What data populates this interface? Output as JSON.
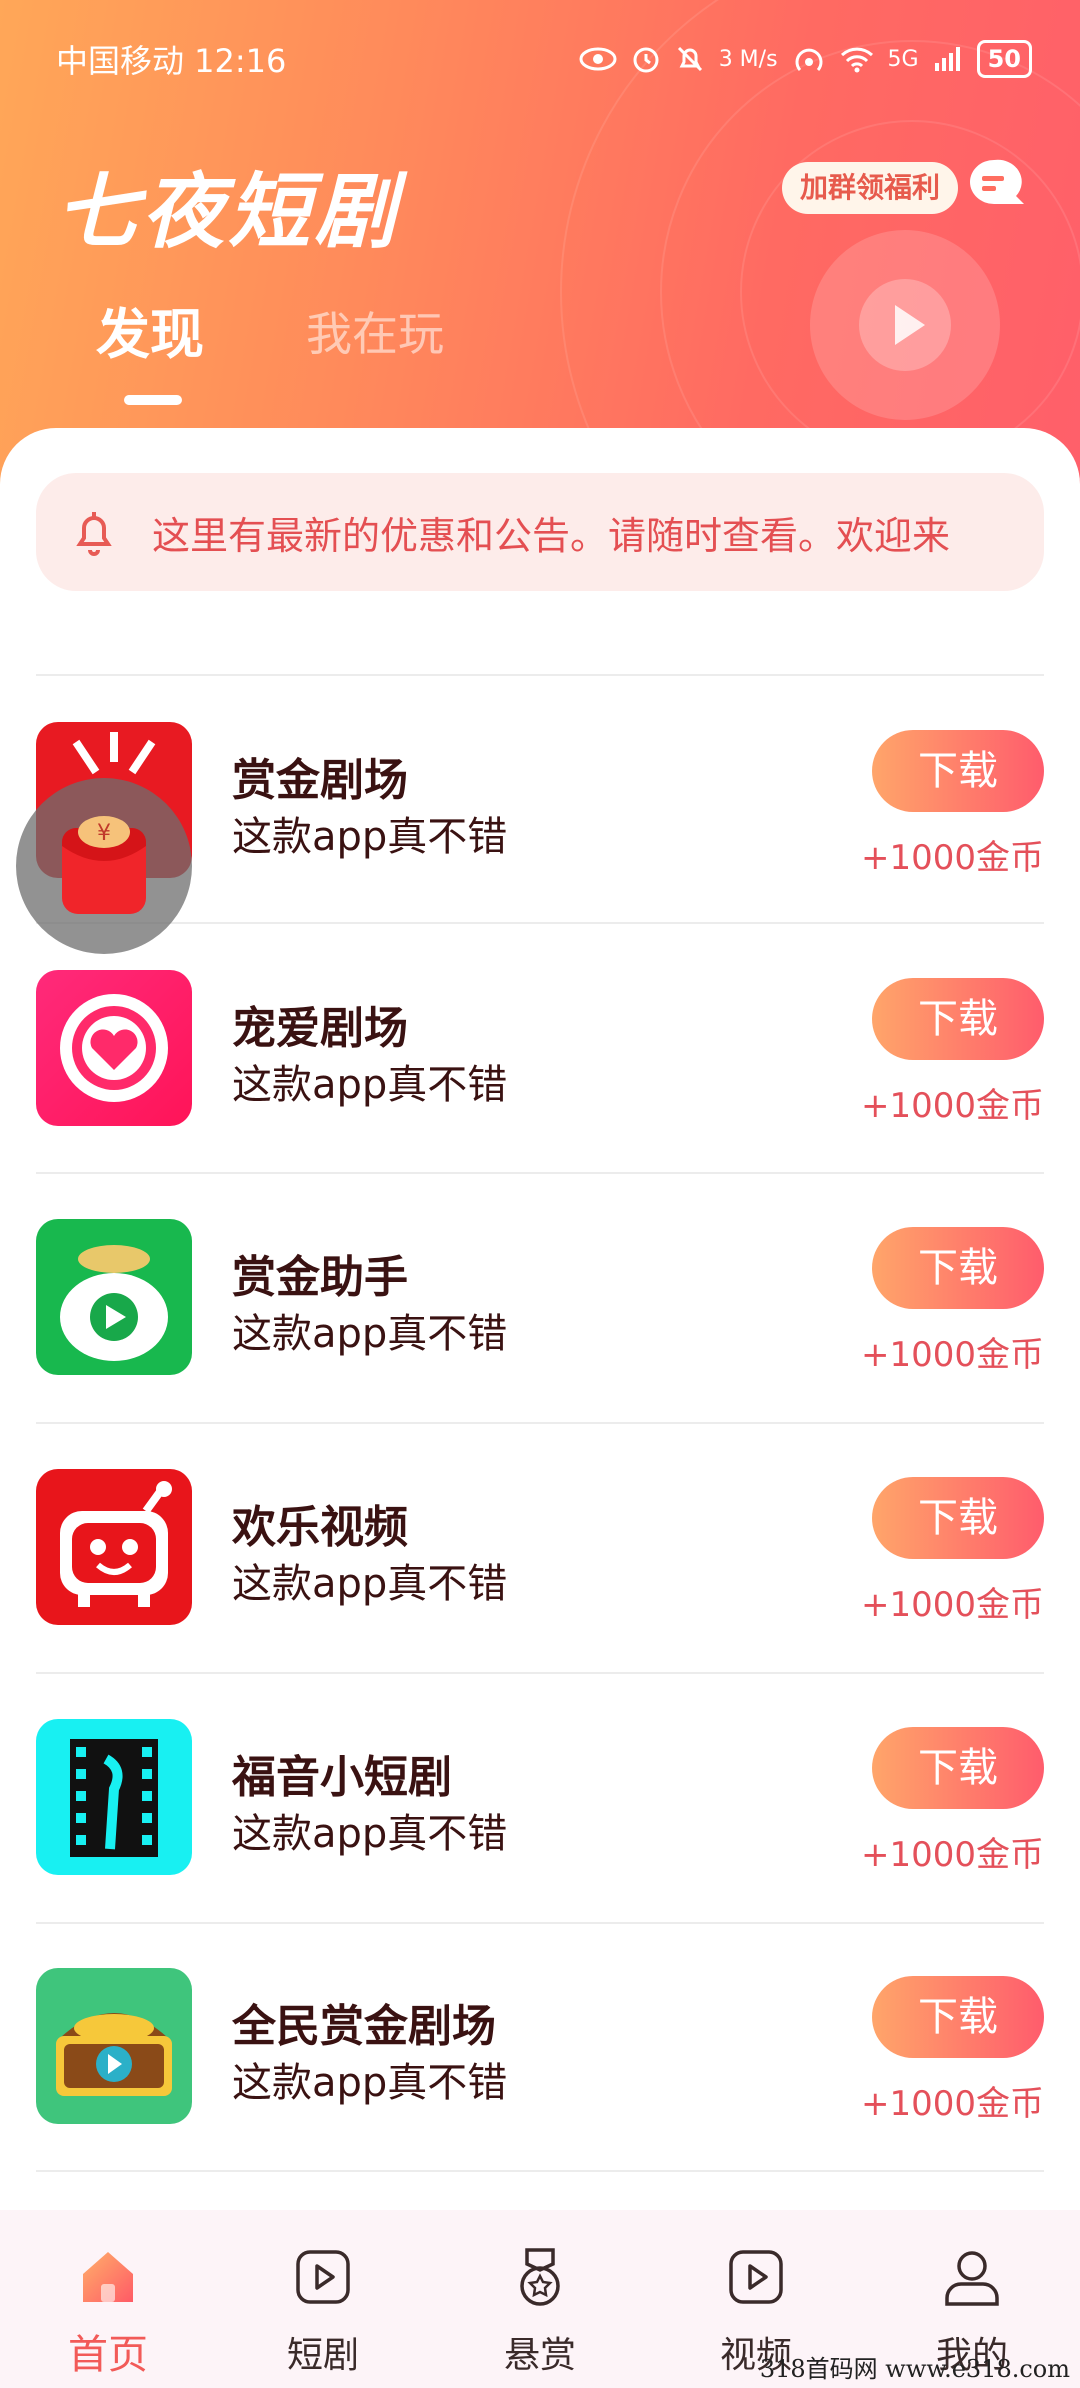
{
  "status_bar": {
    "carrier_time": "中国移动 12:16",
    "speed": "3 M/s",
    "network": "5G",
    "battery": "50"
  },
  "header": {
    "app_title": "七夜短剧",
    "group_button": "加群领福利",
    "tabs": [
      {
        "label": "发现",
        "active": true
      },
      {
        "label": "我在玩",
        "active": false
      }
    ]
  },
  "notice": {
    "text": "这里有最新的优惠和公告。请随时查看。欢迎来"
  },
  "apps": [
    {
      "name": "赏金剧场",
      "desc": "这款app真不错",
      "button": "下载",
      "reward": "+1000金币",
      "icon": "theater-icon"
    },
    {
      "name": "宠爱剧场",
      "desc": "这款app真不错",
      "button": "下载",
      "reward": "+1000金币",
      "icon": "heart-icon"
    },
    {
      "name": "赏金助手",
      "desc": "这款app真不错",
      "button": "下载",
      "reward": "+1000金币",
      "icon": "money-bag-icon"
    },
    {
      "name": "欢乐视频",
      "desc": "这款app真不错",
      "button": "下载",
      "reward": "+1000金币",
      "icon": "tv-face-icon"
    },
    {
      "name": "福音小短剧",
      "desc": "这款app真不错",
      "button": "下载",
      "reward": "+1000金币",
      "icon": "film-strip-icon"
    },
    {
      "name": "全民赏金剧场",
      "desc": "这款app真不错",
      "button": "下载",
      "reward": "+1000金币",
      "icon": "treasure-chest-icon"
    }
  ],
  "floating": {
    "icon": "red-packet-icon",
    "symbol": "¥"
  },
  "nav": [
    {
      "label": "首页",
      "icon": "home-icon",
      "active": true
    },
    {
      "label": "短剧",
      "icon": "play-square-icon",
      "active": false
    },
    {
      "label": "悬赏",
      "icon": "medal-icon",
      "active": false
    },
    {
      "label": "视频",
      "icon": "video-icon",
      "active": false
    },
    {
      "label": "我的",
      "icon": "user-icon",
      "active": false
    }
  ],
  "watermark": "318首码网  www.e318.com",
  "colors": {
    "header_start": "#ffa758",
    "header_end": "#ff5f6a",
    "accent": "#f25a58",
    "button_start": "#ffa56a",
    "button_end": "#ff5c6c",
    "notice_bg": "#fdecea",
    "title_text": "#3a1212"
  }
}
